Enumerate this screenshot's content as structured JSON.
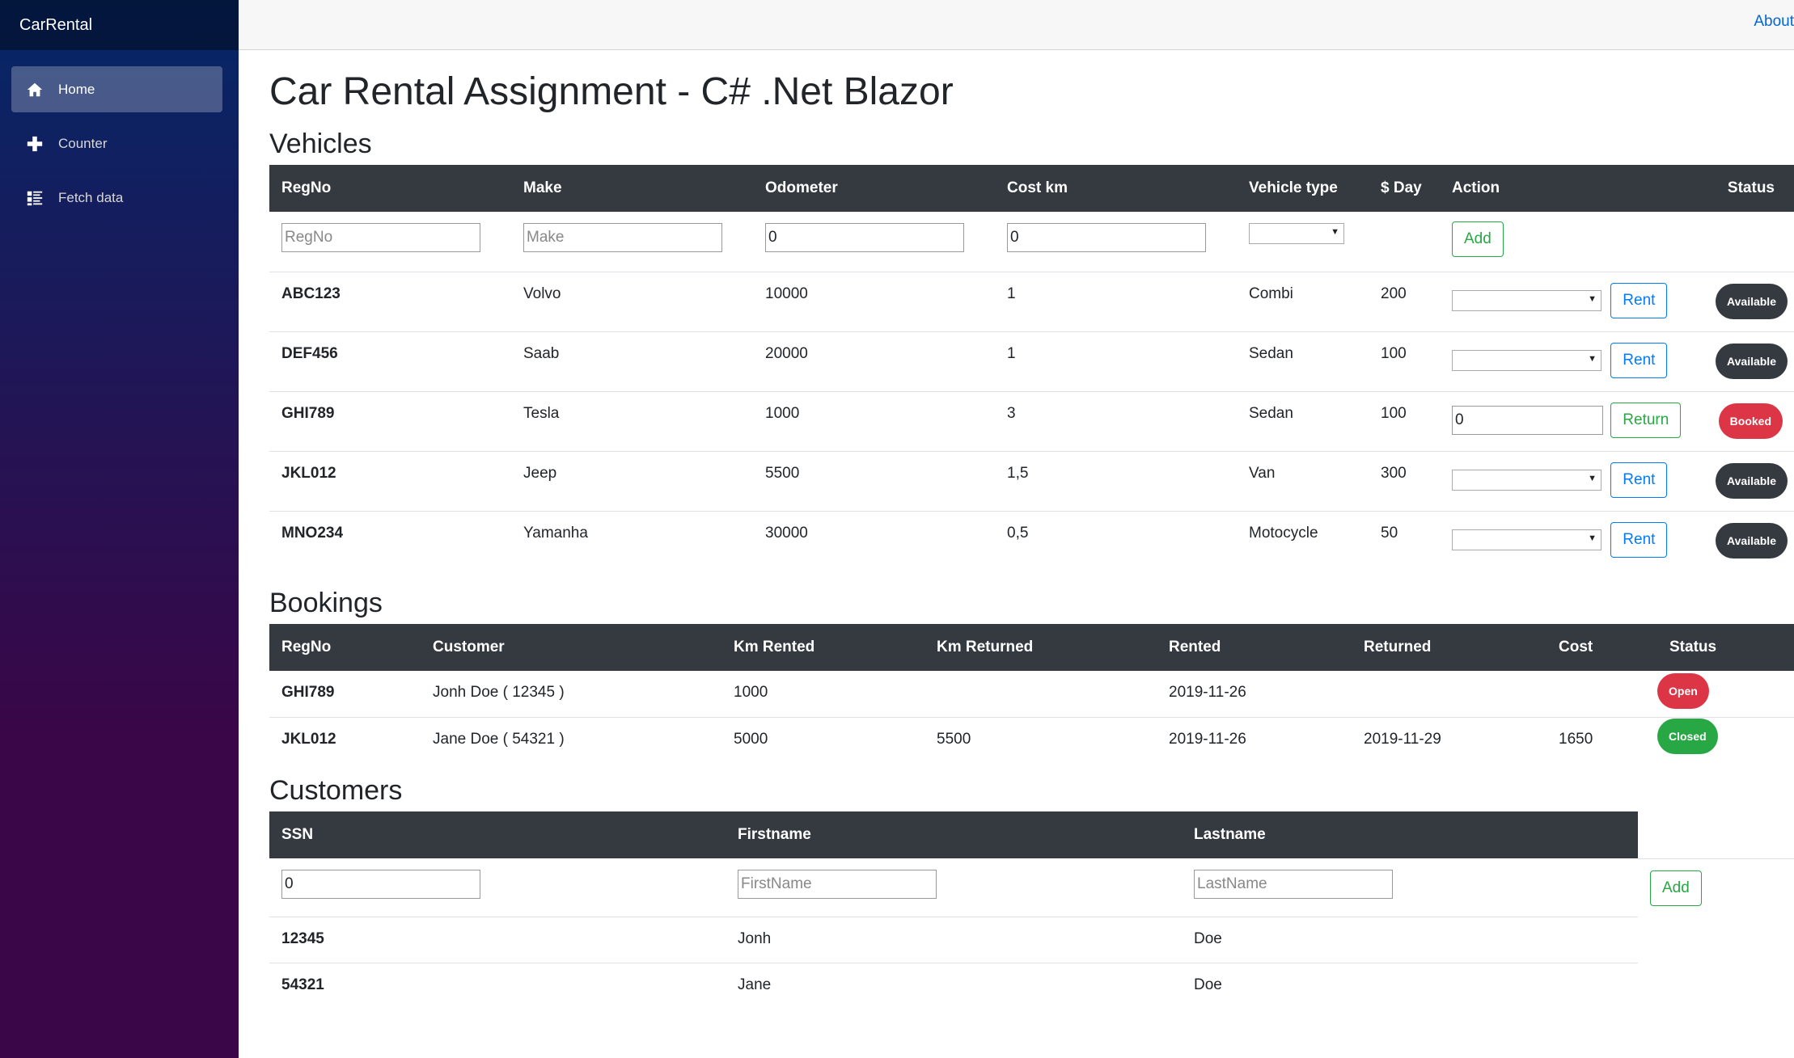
{
  "app": {
    "brand": "CarRental",
    "about": "About"
  },
  "sidebar": {
    "items": [
      {
        "label": "Home",
        "icon": "home-icon",
        "active": true
      },
      {
        "label": "Counter",
        "icon": "plus-icon",
        "active": false
      },
      {
        "label": "Fetch data",
        "icon": "list-rich-icon",
        "active": false
      }
    ]
  },
  "page": {
    "title": "Car Rental Assignment - C# .Net Blazor"
  },
  "vehicles": {
    "heading": "Vehicles",
    "columns": [
      "RegNo",
      "Make",
      "Odometer",
      "Cost km",
      "Vehicle type",
      "$ Day",
      "Action",
      "Status"
    ],
    "new_row": {
      "regno_placeholder": "RegNo",
      "make_placeholder": "Make",
      "odometer_value": "0",
      "costkm_value": "0",
      "add_label": "Add"
    },
    "rows": [
      {
        "regno": "ABC123",
        "make": "Volvo",
        "odometer": "10000",
        "cost_km": "1",
        "type": "Combi",
        "day": "200",
        "action": "Rent",
        "status": "Available",
        "return_value": ""
      },
      {
        "regno": "DEF456",
        "make": "Saab",
        "odometer": "20000",
        "cost_km": "1",
        "type": "Sedan",
        "day": "100",
        "action": "Rent",
        "status": "Available",
        "return_value": ""
      },
      {
        "regno": "GHI789",
        "make": "Tesla",
        "odometer": "1000",
        "cost_km": "3",
        "type": "Sedan",
        "day": "100",
        "action": "Return",
        "status": "Booked",
        "return_value": "0"
      },
      {
        "regno": "JKL012",
        "make": "Jeep",
        "odometer": "5500",
        "cost_km": "1,5",
        "type": "Van",
        "day": "300",
        "action": "Rent",
        "status": "Available",
        "return_value": ""
      },
      {
        "regno": "MNO234",
        "make": "Yamanha",
        "odometer": "30000",
        "cost_km": "0,5",
        "type": "Motocycle",
        "day": "50",
        "action": "Rent",
        "status": "Available",
        "return_value": ""
      }
    ]
  },
  "bookings": {
    "heading": "Bookings",
    "columns": [
      "RegNo",
      "Customer",
      "Km Rented",
      "Km Returned",
      "Rented",
      "Returned",
      "Cost",
      "Status"
    ],
    "rows": [
      {
        "regno": "GHI789",
        "customer": "Jonh Doe ( 12345 )",
        "km_rented": "1000",
        "km_returned": "",
        "rented": "2019-11-26",
        "returned": "",
        "cost": "",
        "status": "Open"
      },
      {
        "regno": "JKL012",
        "customer": "Jane Doe ( 54321 )",
        "km_rented": "5000",
        "km_returned": "5500",
        "rented": "2019-11-26",
        "returned": "2019-11-29",
        "cost": "1650",
        "status": "Closed"
      }
    ]
  },
  "customers": {
    "heading": "Customers",
    "columns": [
      "SSN",
      "Firstname",
      "Lastname"
    ],
    "new_row": {
      "ssn_value": "0",
      "firstname_placeholder": "FirstName",
      "lastname_placeholder": "LastName",
      "add_label": "Add"
    },
    "rows": [
      {
        "ssn": "12345",
        "firstname": "Jonh",
        "lastname": "Doe"
      },
      {
        "ssn": "54321",
        "firstname": "Jane",
        "lastname": "Doe"
      }
    ]
  },
  "colors": {
    "header_dark": "#343a40",
    "available": "#343a40",
    "booked": "#dc3545",
    "open": "#dc3545",
    "closed": "#28a745",
    "link": "#0366d6"
  }
}
